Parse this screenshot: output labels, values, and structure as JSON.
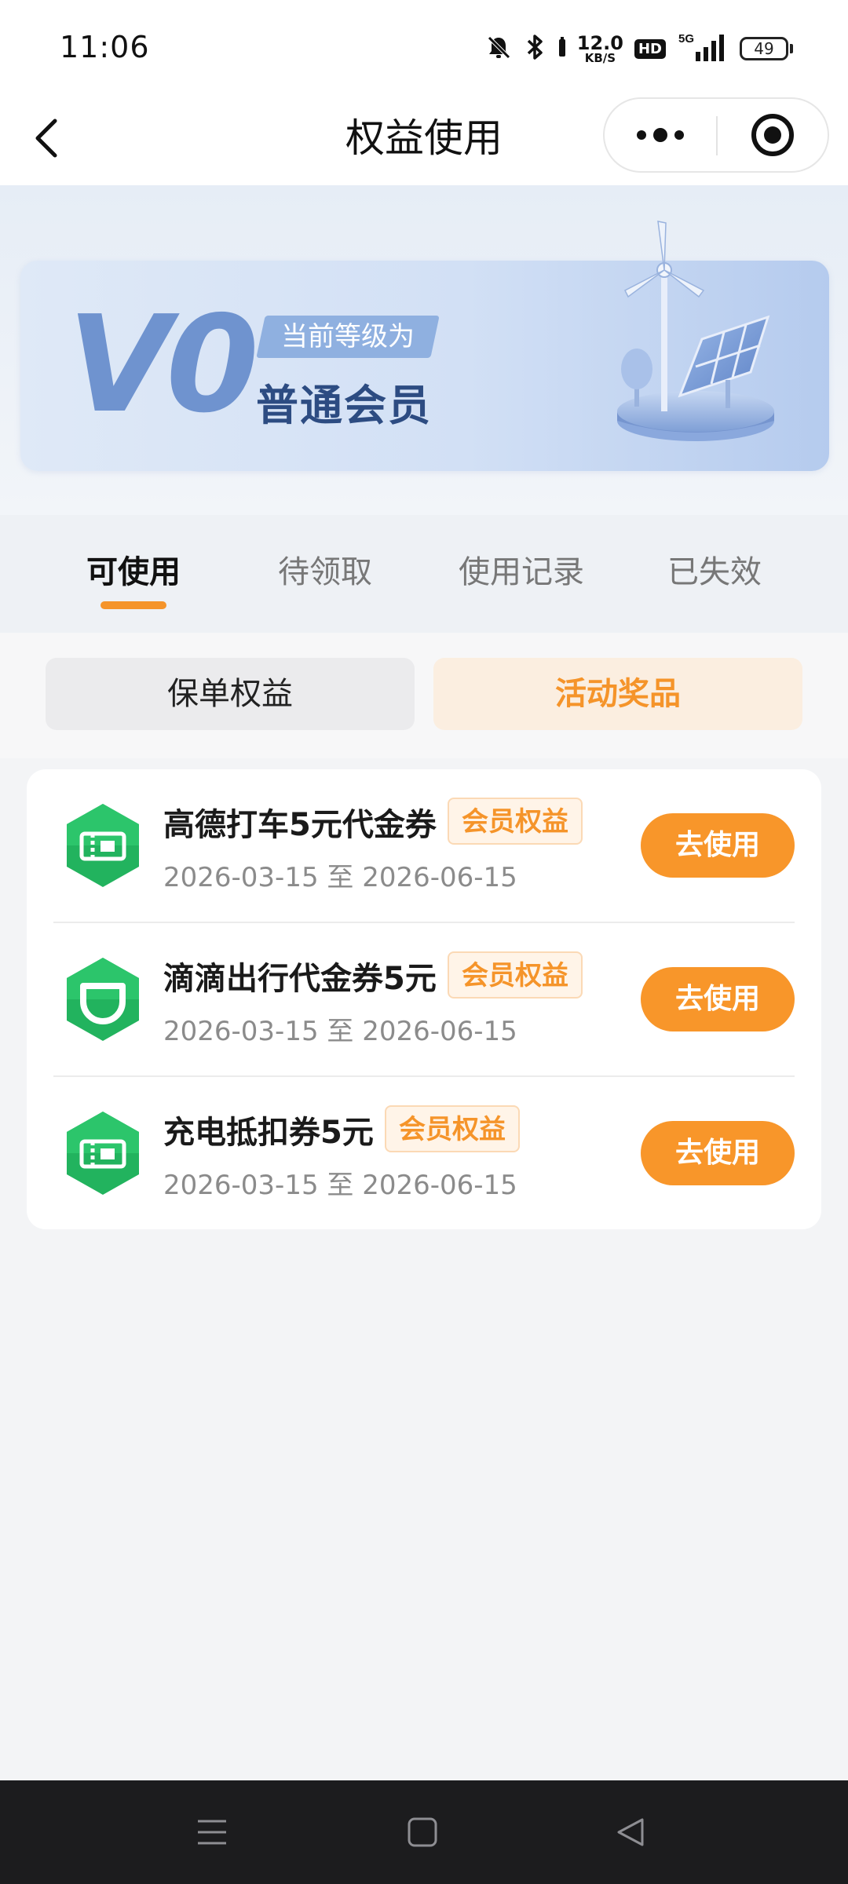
{
  "status_bar": {
    "time": "11:06",
    "icons": [
      "mute-bell-icon",
      "bluetooth-icon",
      "hd-icon",
      "5g-signal-icon",
      "battery-icon"
    ],
    "net_speed_value": "12.0",
    "net_speed_unit": "KB/S",
    "hd_label": "HD",
    "network_label": "5G",
    "battery_level": "49"
  },
  "nav": {
    "title": "权益使用",
    "back_icon": "chevron-left-icon",
    "more_icon": "more-dots-icon",
    "close_icon": "target-close-icon"
  },
  "member": {
    "level_code": "V0",
    "level_prefix": "当前等级为",
    "level_name": "普通会员",
    "illustration": "wind-turbine-solar-illustration"
  },
  "tabs": [
    {
      "label": "可使用",
      "active": true
    },
    {
      "label": "待领取",
      "active": false
    },
    {
      "label": "使用记录",
      "active": false
    },
    {
      "label": "已失效",
      "active": false
    }
  ],
  "segments": [
    {
      "label": "保单权益",
      "active": false
    },
    {
      "label": "活动奖品",
      "active": true
    }
  ],
  "items": [
    {
      "icon": "ticket-voucher-icon",
      "title": "高德打车5元代金券",
      "badge": "会员权益",
      "date": "2026-03-15 至 2026-06-15",
      "action": "去使用"
    },
    {
      "icon": "didi-logo-icon",
      "title": "滴滴出行代金券5元",
      "badge": "会员权益",
      "date": "2026-03-15 至 2026-06-15",
      "action": "去使用"
    },
    {
      "icon": "ticket-voucher-icon",
      "title": "充电抵扣券5元",
      "badge": "会员权益",
      "date": "2026-03-15 至 2026-06-15",
      "action": "去使用"
    }
  ],
  "colors": {
    "accent": "#f8962a",
    "icon_green": "#22b35e",
    "title_text": "#111111",
    "muted_text": "#8b8b8b"
  },
  "system_nav": {
    "icons": [
      "menu-icon",
      "home-square-icon",
      "back-triangle-icon"
    ]
  }
}
